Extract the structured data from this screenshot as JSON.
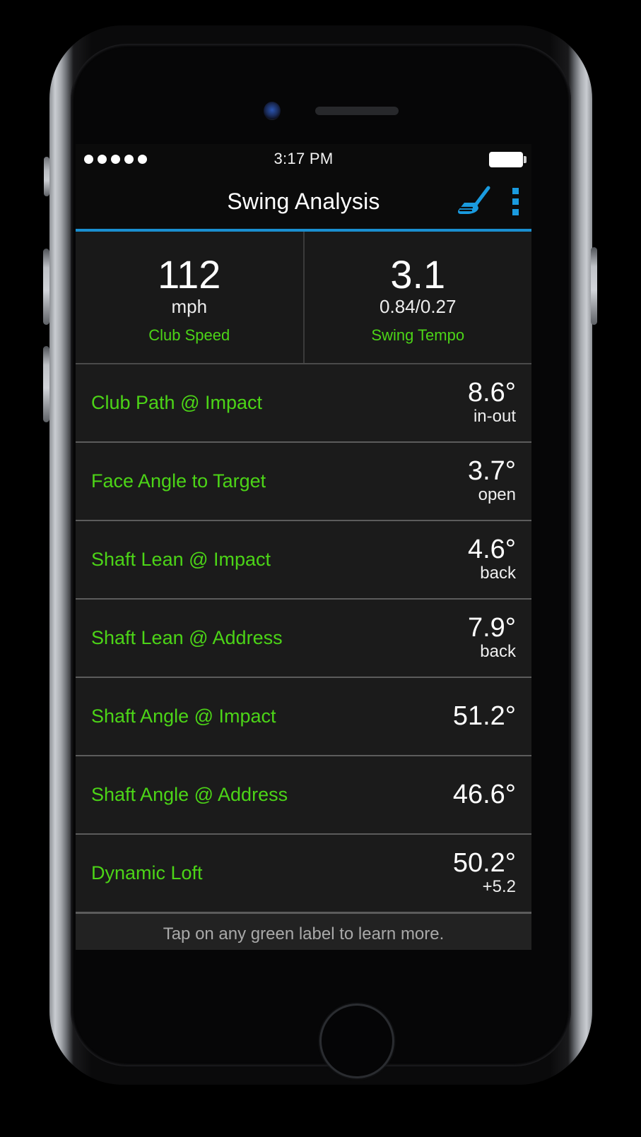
{
  "status_bar": {
    "signal_dots": 5,
    "time": "3:17 PM",
    "battery_icon": "battery-full-icon"
  },
  "title_bar": {
    "title": "Swing Analysis",
    "club_icon": "golf-club-icon",
    "overflow_icon": "overflow-menu-icon",
    "accent_color": "#1a8fd0"
  },
  "summary_cards": [
    {
      "value": "112",
      "sub": "mph",
      "label": "Club Speed"
    },
    {
      "value": "3.1",
      "sub": "0.84/0.27",
      "label": "Swing Tempo"
    }
  ],
  "metrics": [
    {
      "label": "Club Path @ Impact",
      "value": "8.6°",
      "unit": "in-out"
    },
    {
      "label": "Face Angle to Target",
      "value": "3.7°",
      "unit": "open"
    },
    {
      "label": "Shaft Lean @ Impact",
      "value": "4.6°",
      "unit": "back"
    },
    {
      "label": "Shaft Lean @ Address",
      "value": "7.9°",
      "unit": "back"
    },
    {
      "label": "Shaft Angle @ Impact",
      "value": "51.2°",
      "unit": ""
    },
    {
      "label": "Shaft Angle @ Address",
      "value": "46.6°",
      "unit": ""
    },
    {
      "label": "Dynamic Loft",
      "value": "50.2°",
      "unit": "+5.2"
    }
  ],
  "footer": {
    "hint": "Tap on any green label to learn more."
  },
  "colors": {
    "green_label": "#4cd417",
    "blue_accent": "#1a9bdf",
    "card_bg": "#191919",
    "row_bg": "#1b1b1b"
  }
}
